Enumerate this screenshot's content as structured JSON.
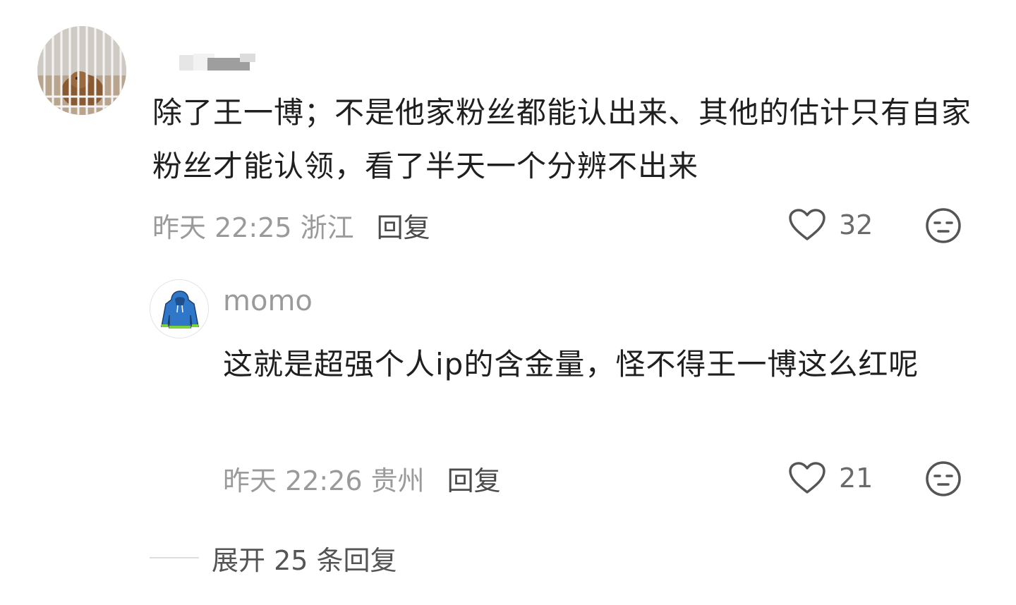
{
  "comment": {
    "text": "除了王一博；不是他家粉丝都能认出来、其他的估计只有自家粉丝才能认领，看了半天一个分辨不出来",
    "time_location": "昨天 22:25 浙江",
    "reply_label": "回复",
    "likes": "32"
  },
  "reply": {
    "username": "momo",
    "text": "这就是超强个人ip的含金量，怪不得王一博这么红呢",
    "time_location": "昨天 22:26 贵州",
    "reply_label": "回复",
    "likes": "21"
  },
  "expand": {
    "label": "展开 25 条回复"
  },
  "colors": {
    "meta_gray": "#9a9a9a",
    "text": "#1f1f1f",
    "icon_gray": "#555555",
    "hoodie_blue": "#2f78c9",
    "hoodie_green": "#7dd13a"
  },
  "icons": {
    "like": "heart-outline-icon",
    "dislike": "neutral-face-icon"
  }
}
